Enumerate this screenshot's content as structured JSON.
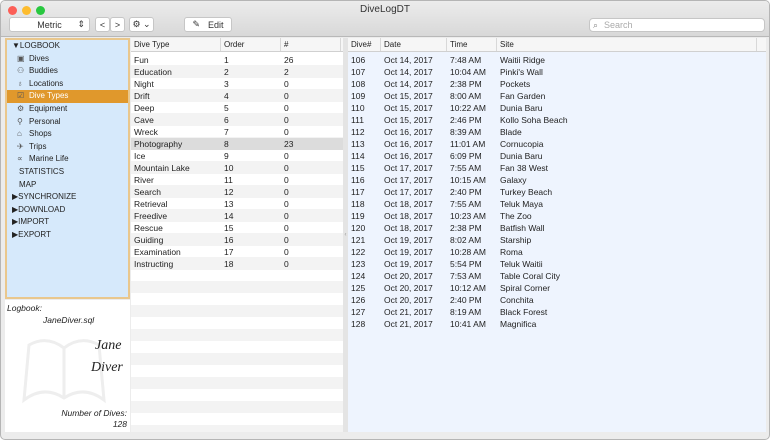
{
  "window": {
    "title": "DiveLogDT"
  },
  "toolbar": {
    "units": "Metric",
    "back": "<",
    "forward": ">",
    "gear": "⚙ ⌄",
    "edit": "Edit",
    "search_placeholder": "Search"
  },
  "sidebar": {
    "items": [
      {
        "label": "▼LOGBOOK",
        "icon": "",
        "level": 0
      },
      {
        "label": "Dives",
        "icon": "▣",
        "level": 1
      },
      {
        "label": "Buddies",
        "icon": "⚇",
        "level": 1
      },
      {
        "label": "Locations",
        "icon": "♁",
        "level": 1
      },
      {
        "label": "Dive Types",
        "icon": "☑",
        "level": 1,
        "selected": true
      },
      {
        "label": "Equipment",
        "icon": "⚙",
        "level": 1
      },
      {
        "label": "Personal",
        "icon": "⚲",
        "level": 1
      },
      {
        "label": "Shops",
        "icon": "⌂",
        "level": 1
      },
      {
        "label": "Trips",
        "icon": "✈",
        "level": 1
      },
      {
        "label": "Marine Life",
        "icon": "∝",
        "level": 1
      },
      {
        "label": "STATISTICS",
        "icon": "",
        "level": 2
      },
      {
        "label": "MAP",
        "icon": "",
        "level": 2
      },
      {
        "label": "▶SYNCHRONIZE",
        "icon": "",
        "level": 0
      },
      {
        "label": "▶DOWNLOAD",
        "icon": "",
        "level": 0
      },
      {
        "label": "▶IMPORT",
        "icon": "",
        "level": 0
      },
      {
        "label": "▶EXPORT",
        "icon": "",
        "level": 0
      }
    ]
  },
  "info": {
    "logbook_label": "Logbook:",
    "logbook_file": "JaneDiver.sql",
    "signature_first": "Jane",
    "signature_last": "Diver",
    "dives_label": "Number of Dives:",
    "dives_count": "128"
  },
  "dive_types": {
    "columns": [
      "Dive Type",
      "Order",
      "#"
    ],
    "rows": [
      [
        "Fun",
        "1",
        "26"
      ],
      [
        "Education",
        "2",
        "2"
      ],
      [
        "Night",
        "3",
        "0"
      ],
      [
        "Drift",
        "4",
        "0"
      ],
      [
        "Deep",
        "5",
        "0"
      ],
      [
        "Cave",
        "6",
        "0"
      ],
      [
        "Wreck",
        "7",
        "0"
      ],
      [
        "Photography",
        "8",
        "23"
      ],
      [
        "Ice",
        "9",
        "0"
      ],
      [
        "Mountain Lake",
        "10",
        "0"
      ],
      [
        "River",
        "11",
        "0"
      ],
      [
        "Search",
        "12",
        "0"
      ],
      [
        "Retrieval",
        "13",
        "0"
      ],
      [
        "Freedive",
        "14",
        "0"
      ],
      [
        "Rescue",
        "15",
        "0"
      ],
      [
        "Guiding",
        "16",
        "0"
      ],
      [
        "Examination",
        "17",
        "0"
      ],
      [
        "Instructing",
        "18",
        "0"
      ]
    ],
    "selected_index": 7
  },
  "dives": {
    "columns": [
      "Dive#",
      "Date",
      "Time",
      "Site"
    ],
    "rows": [
      [
        "106",
        "Oct 14, 2017",
        "7:48 AM",
        "Waitii Ridge"
      ],
      [
        "107",
        "Oct 14, 2017",
        "10:04 AM",
        "Pinki's Wall"
      ],
      [
        "108",
        "Oct 14, 2017",
        "2:38 PM",
        "Pockets"
      ],
      [
        "109",
        "Oct 15, 2017",
        "8:00 AM",
        "Fan Garden"
      ],
      [
        "110",
        "Oct 15, 2017",
        "10:22 AM",
        "Dunia Baru"
      ],
      [
        "111",
        "Oct 15, 2017",
        "2:46 PM",
        "Kollo Soha Beach"
      ],
      [
        "112",
        "Oct 16, 2017",
        "8:39 AM",
        "Blade"
      ],
      [
        "113",
        "Oct 16, 2017",
        "11:01 AM",
        "Cornucopia"
      ],
      [
        "114",
        "Oct 16, 2017",
        "6:09 PM",
        "Dunia Baru"
      ],
      [
        "115",
        "Oct 17, 2017",
        "7:55 AM",
        "Fan 38 West"
      ],
      [
        "116",
        "Oct 17, 2017",
        "10:15 AM",
        "Galaxy"
      ],
      [
        "117",
        "Oct 17, 2017",
        "2:40 PM",
        "Turkey Beach"
      ],
      [
        "118",
        "Oct 18, 2017",
        "7:55 AM",
        "Teluk Maya"
      ],
      [
        "119",
        "Oct 18, 2017",
        "10:23 AM",
        "The Zoo"
      ],
      [
        "120",
        "Oct 18, 2017",
        "2:38 PM",
        "Batfish Wall"
      ],
      [
        "121",
        "Oct 19, 2017",
        "8:02 AM",
        "Starship"
      ],
      [
        "122",
        "Oct 19, 2017",
        "10:28 AM",
        "Roma"
      ],
      [
        "123",
        "Oct 19, 2017",
        "5:54 PM",
        "Teluk Waitii"
      ],
      [
        "124",
        "Oct 20, 2017",
        "7:53 AM",
        "Table Coral City"
      ],
      [
        "125",
        "Oct 20, 2017",
        "10:12 AM",
        "Spiral Corner"
      ],
      [
        "126",
        "Oct 20, 2017",
        "2:40 PM",
        "Conchita"
      ],
      [
        "127",
        "Oct 21, 2017",
        "8:19 AM",
        "Black Forest"
      ],
      [
        "128",
        "Oct 21, 2017",
        "10:41 AM",
        "Magnifica"
      ]
    ]
  }
}
